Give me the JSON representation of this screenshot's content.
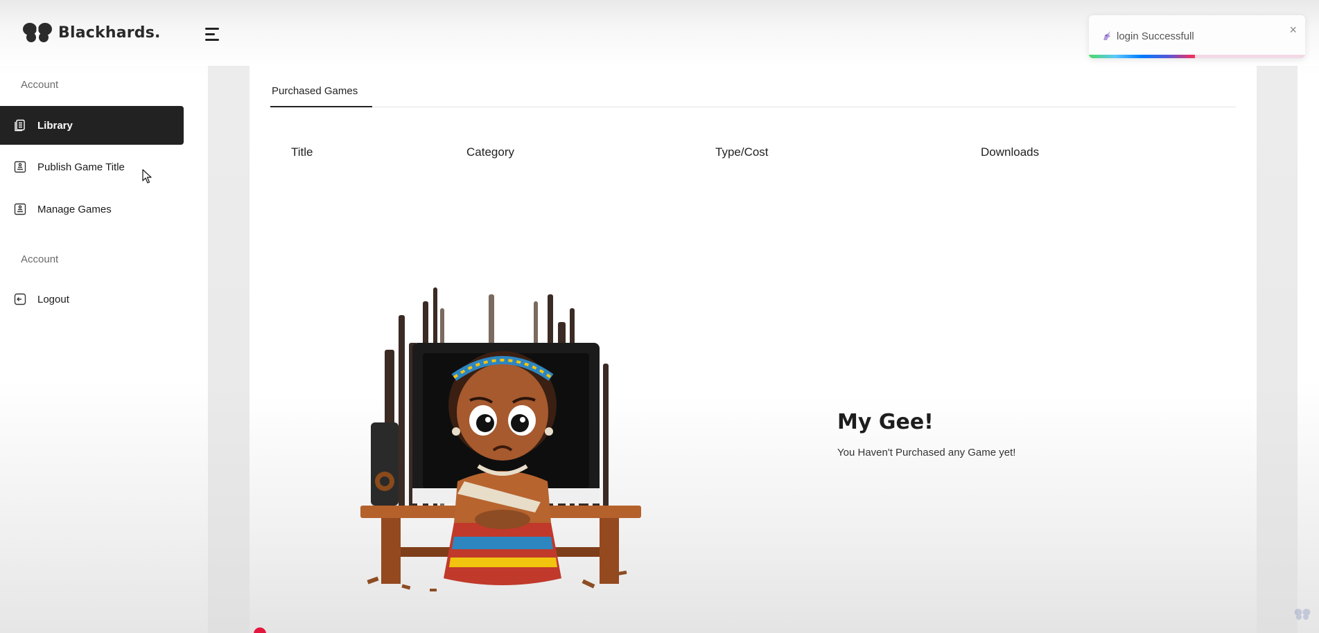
{
  "brand": {
    "name": "Blackhards."
  },
  "toast": {
    "message": "login Successfull",
    "close_glyph": "×",
    "progress": 0.49
  },
  "sidebar": {
    "section_1_label": "Account",
    "section_2_label": "Account",
    "items": [
      {
        "label": "Library",
        "icon": "library-icon",
        "active": true
      },
      {
        "label": "Publish Game Title",
        "icon": "publish-icon",
        "active": false
      },
      {
        "label": "Manage Games",
        "icon": "manage-icon",
        "active": false
      },
      {
        "label": "Logout",
        "icon": "logout-icon",
        "active": false
      }
    ]
  },
  "main": {
    "tabs": [
      {
        "label": "Purchased Games",
        "active": true
      }
    ],
    "table": {
      "columns": [
        "Title",
        "Category",
        "Type/Cost",
        "Downloads"
      ],
      "rows": []
    },
    "empty_state": {
      "title": "My Gee!",
      "message": "You Haven't Purchased any Game yet!"
    }
  },
  "colors": {
    "active_nav_bg": "#222222",
    "active_nav_text": "#ffffff",
    "accent_red": "#e3173e"
  }
}
